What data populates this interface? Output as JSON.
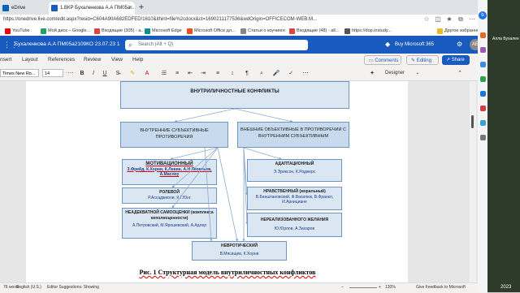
{
  "tabs": [
    {
      "label": "eDrive"
    },
    {
      "label": "1.ВКР Бухаленкова А.А ПМ05а..."
    }
  ],
  "address_url": "https://onedrive.live.com/edit.aspx?resid=C604A90A682EDFED!1610&ithint=file%2cdocx&ct=1690211177536&wdOrigin=OFFICECOM-WEB.M...",
  "bookmarks": [
    "YouTube",
    "Мой диск – Google...",
    "Входящие (305) - a...",
    "Microsoft Edge",
    "Microsoft Office дл...",
    "Статьи о коучинге",
    "Входящие (48) - all...",
    "https://dop.instudy...",
    "Другое избранное"
  ],
  "word": {
    "doc_name": "Бухаленкова А.А ПМ05а2109КО 23.07.23 1",
    "search_placeholder": "Search (Alt + Q)",
    "buy": "Buy Microsoft 365",
    "avatar": "АБ"
  },
  "menu": {
    "items": [
      "nsert",
      "Layout",
      "References",
      "Review",
      "View",
      "Help"
    ],
    "comments": "Comments",
    "editing": "Editing",
    "share": "Share"
  },
  "toolbar": {
    "font": "Times New Ro...",
    "size": "14",
    "designer": "Designer"
  },
  "diagram": {
    "top": "ВНУТРИЛИЧНОСТНЫЕ КОНФЛИКТЫ",
    "left_head": "ВНУТРЕННИЕ СУБЪЕКТИВНЫЕ ПРОТИВОРЕЧИЯ",
    "right_head": "ВНЕШНИЕ ОБЪЕКТИВНЫЕ В ПРОТИВОРЕЧИИ С ВНУТРЕННИМ СУБЪЕКТИВНЫМ",
    "motiv_title": "МОТИВАЦИОННЫЙ",
    "motiv_auth": "З.Фрейд, К.Хорни, К.Левин, А.Н Леонтьев, А.Маслоу",
    "role_title": "РОЛЕВОЙ",
    "role_auth": "Р.Ассаджиоли, К.Г.Юнг",
    "self_title": "НЕАДЕКВАТНОЙ САМООЦЕНКИ (комплекса неполноценности)",
    "self_auth": "А.Петровский, М.Ярошевский, А.Адлер",
    "adapt_title": "АДАПТАЦИОННЫЙ",
    "adapt_auth": "Э.Эриксон, К.Роджерс",
    "moral_title": "НРАВСТВЕННЫЙ (моральный)",
    "moral_auth": "В.Банштановский, Ф.Василюк, В.Франкл, И.Арнициане",
    "unreal_title": "НЕРЕАЛИЗОВАННОГО ЖЕЛАНИЯ",
    "unreal_auth": "Ю.Юрлов, А.Захаров",
    "neuro_title": "НЕВРОТИЧЕСКИЙ",
    "neuro_auth": "В.Мясищев, К.Хорни",
    "caption": "Рис. 1 Структурная модель внутриличностных конфликтов"
  },
  "status": {
    "words": "76 words",
    "language": "English (U.S.)",
    "suggestions": "Editor Suggestions: Showing",
    "zoom": "130%",
    "feedback": "Give Feedback to Microsoft"
  },
  "desktop": {
    "user": "Алла Бухален",
    "year": "2023"
  },
  "colors": {
    "word_blue": "#185abd",
    "box_border": "#6f95c3",
    "box_fill": "#dbe6f3"
  }
}
